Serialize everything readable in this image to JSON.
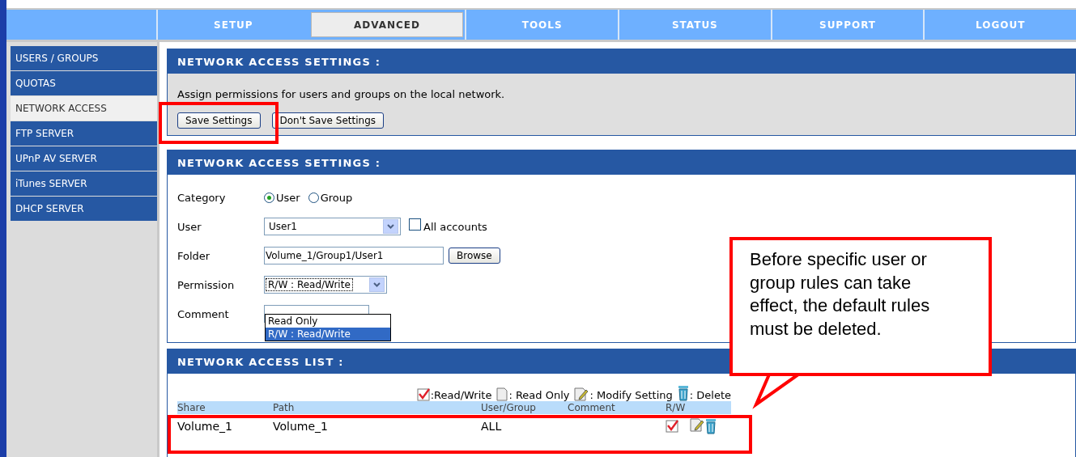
{
  "nav_tabs": [
    {
      "label": "SETUP",
      "selected": false
    },
    {
      "label": "ADVANCED",
      "selected": true
    },
    {
      "label": "TOOLS",
      "selected": false
    },
    {
      "label": "STATUS",
      "selected": false
    },
    {
      "label": "SUPPORT",
      "selected": false
    },
    {
      "label": "LOGOUT",
      "selected": false
    }
  ],
  "sidebar": {
    "items": [
      {
        "label": "USERS / GROUPS",
        "selected": false
      },
      {
        "label": "QUOTAS",
        "selected": false
      },
      {
        "label": "NETWORK ACCESS",
        "selected": true
      },
      {
        "label": "FTP SERVER",
        "selected": false
      },
      {
        "label": "UPnP AV SERVER",
        "selected": false
      },
      {
        "label": "iTunes SERVER",
        "selected": false
      },
      {
        "label": "DHCP SERVER",
        "selected": false
      }
    ]
  },
  "intro_panel": {
    "title": "NETWORK ACCESS SETTINGS :",
    "description": "Assign permissions for users and groups on the local network.",
    "buttons": [
      "Save Settings",
      "Don't Save Settings"
    ]
  },
  "settings_panel": {
    "title": "NETWORK ACCESS SETTINGS :",
    "category": {
      "label": "Category",
      "options": [
        {
          "label": "User",
          "selected": true
        },
        {
          "label": "Group",
          "selected": false
        }
      ]
    },
    "user": {
      "label": "User",
      "value": "User1",
      "all_accounts": {
        "label": "All accounts",
        "checked": false
      }
    },
    "folder": {
      "label": "Folder",
      "value": "Volume_1/Group1/User1",
      "button": "Browse"
    },
    "permission": {
      "label": "Permission",
      "value": "R/W : Read/Write",
      "expanded": true,
      "options": [
        {
          "label": "Read Only",
          "selected": false
        },
        {
          "label": "R/W : Read/Write",
          "selected": true
        }
      ]
    },
    "comment": {
      "label": "Comment"
    }
  },
  "list_panel": {
    "title": "NETWORK ACCESS LIST :",
    "legend": [
      {
        "kind": "read_write",
        "label": ":Read/Write"
      },
      {
        "kind": "read_only",
        "label": ": Read Only"
      },
      {
        "kind": "modify",
        "label": ": Modify Setting"
      },
      {
        "kind": "delete",
        "label": ": Delete"
      }
    ],
    "columns": [
      "Share",
      "Path",
      "User/Group",
      "Comment",
      "R/W"
    ],
    "rows": [
      {
        "share": "Volume_1",
        "path": "Volume_1",
        "user_group": "ALL",
        "read_write": true
      }
    ]
  },
  "callout": {
    "text": "Before specific user or group rules can take effect, the default rules must be deleted."
  }
}
